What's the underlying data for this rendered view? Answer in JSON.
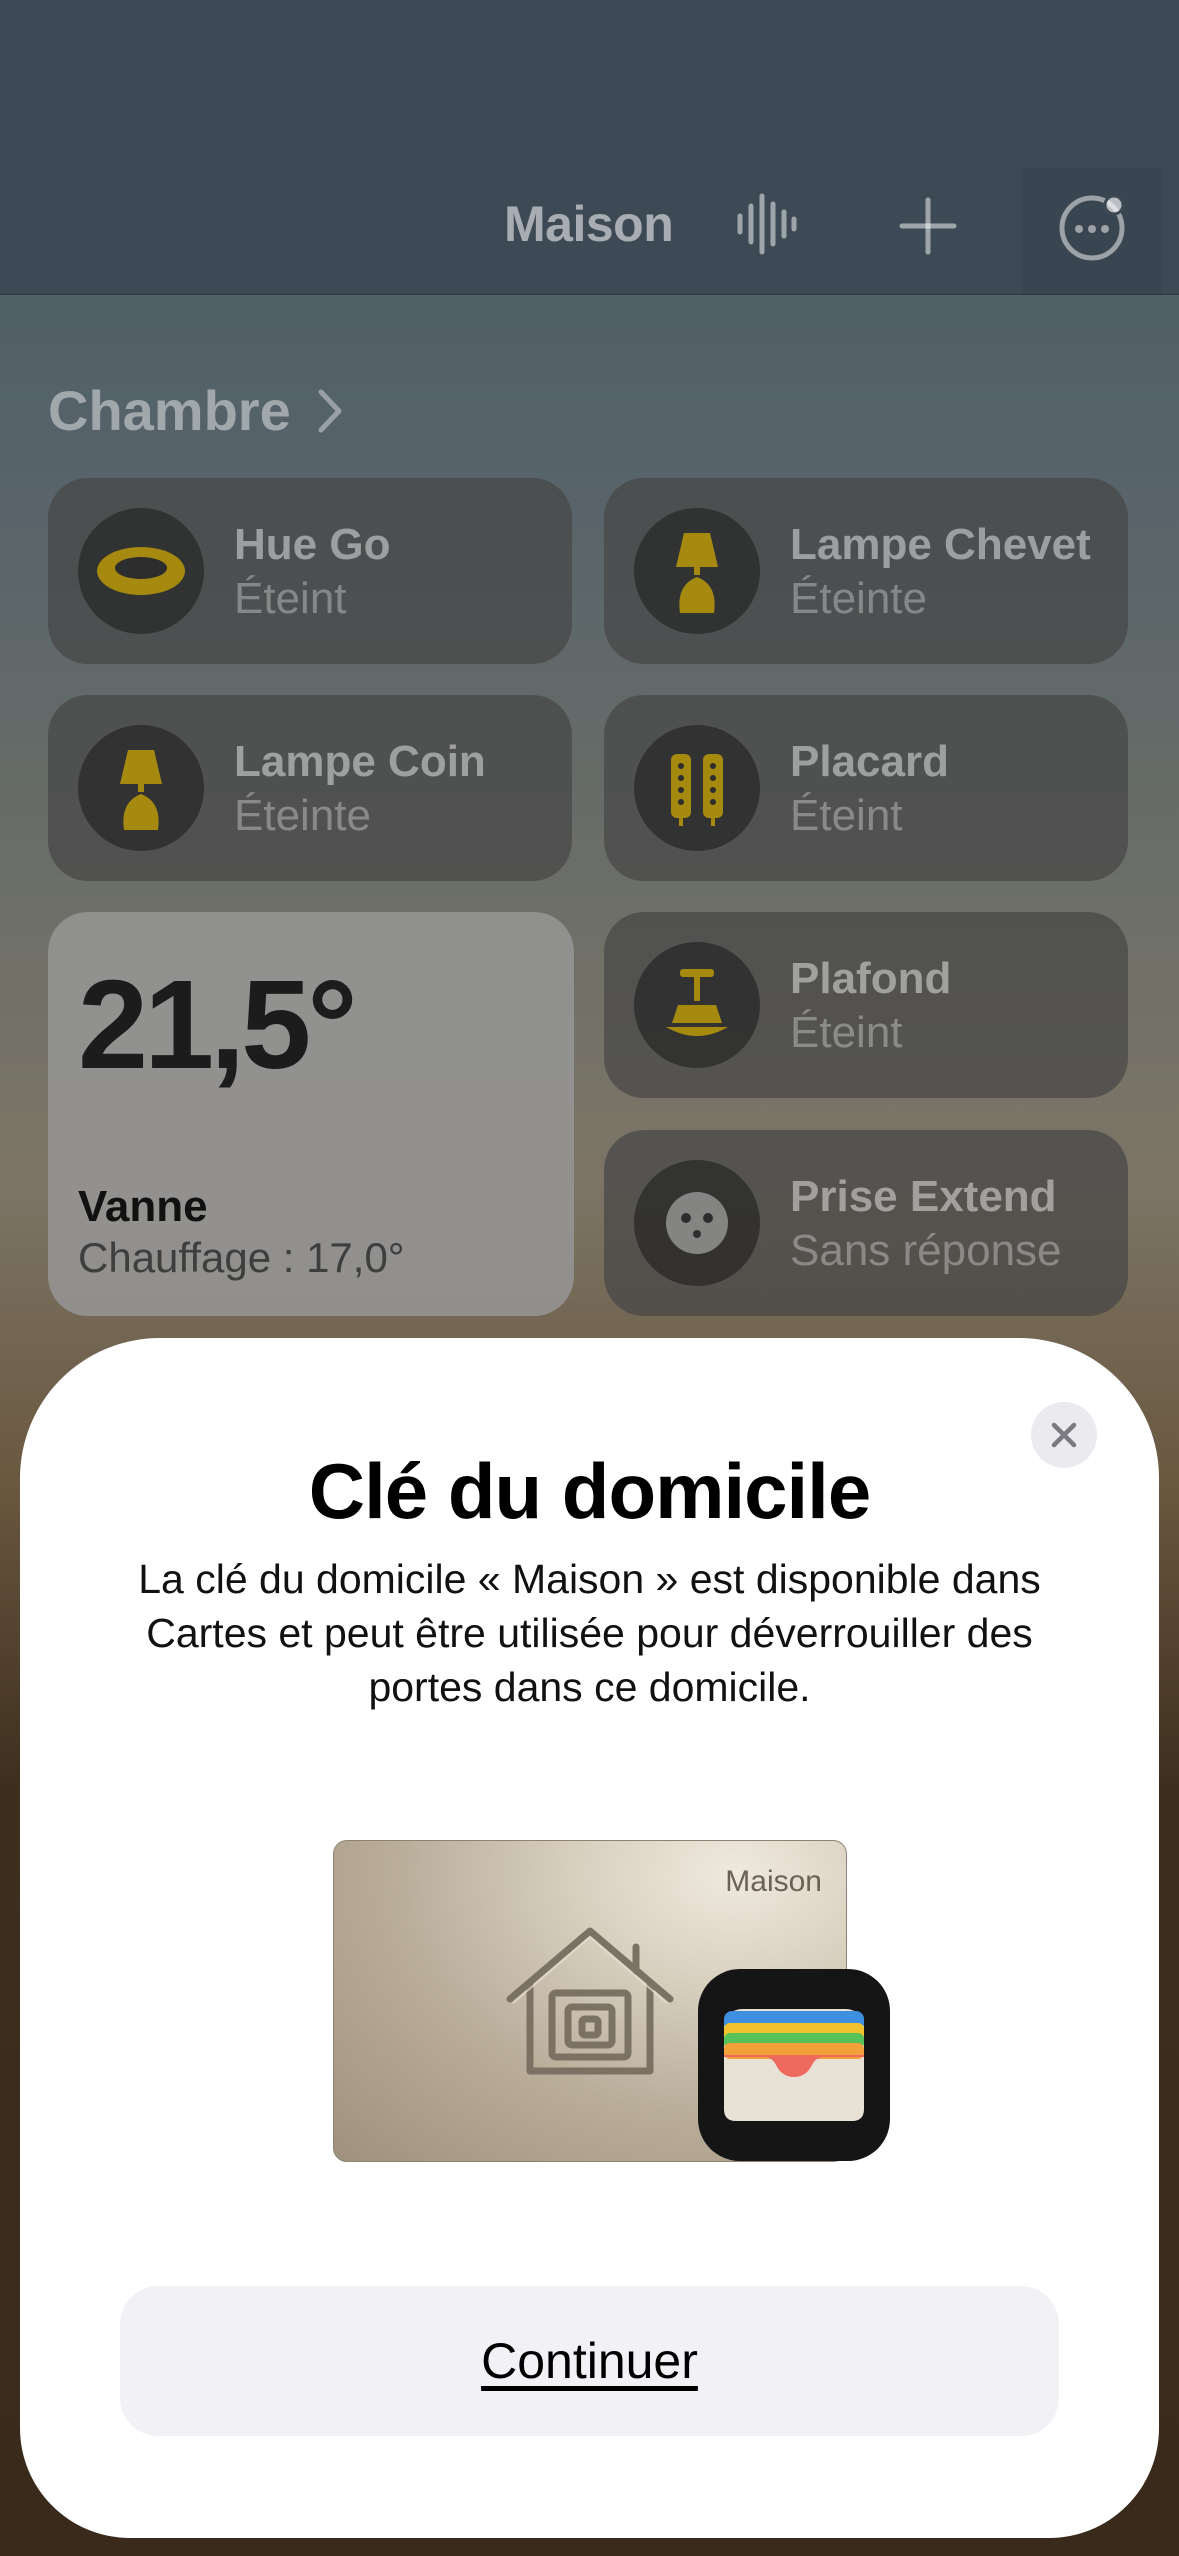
{
  "nav": {
    "title": "Maison",
    "icons": [
      "waveform-icon",
      "plus-icon",
      "more-icon"
    ]
  },
  "room": {
    "title": "Chambre"
  },
  "tiles": [
    {
      "name": "Hue Go",
      "status": "Éteint",
      "icon": "hue-go-icon"
    },
    {
      "name": "Lampe Chevet",
      "status": "Éteinte",
      "icon": "lamp-icon"
    },
    {
      "name": "Lampe Coin",
      "status": "Éteinte",
      "icon": "lamp-icon"
    },
    {
      "name": "Placard",
      "status": "Éteint",
      "icon": "light-strip-icon"
    },
    {
      "name": "Plafond",
      "status": "Éteint",
      "icon": "ceiling-light-icon"
    },
    {
      "name": "Prise Extend",
      "status": "Sans réponse",
      "icon": "outlet-icon"
    }
  ],
  "thermostat": {
    "temperature": "21,5°",
    "name": "Vanne",
    "status": "Chauffage : 17,0°"
  },
  "sheet": {
    "title": "Clé du domicile",
    "description": "La clé du domicile « Maison » est disponible dans Cartes et peut être utilisée pour déverrouiller des portes dans ce domicile.",
    "card_label": "Maison",
    "button_label": "Continuer"
  },
  "colors": {
    "accent_yellow": "#a68a10",
    "sheet_bg": "#ffffff",
    "button_bg": "#f2f2f6"
  }
}
